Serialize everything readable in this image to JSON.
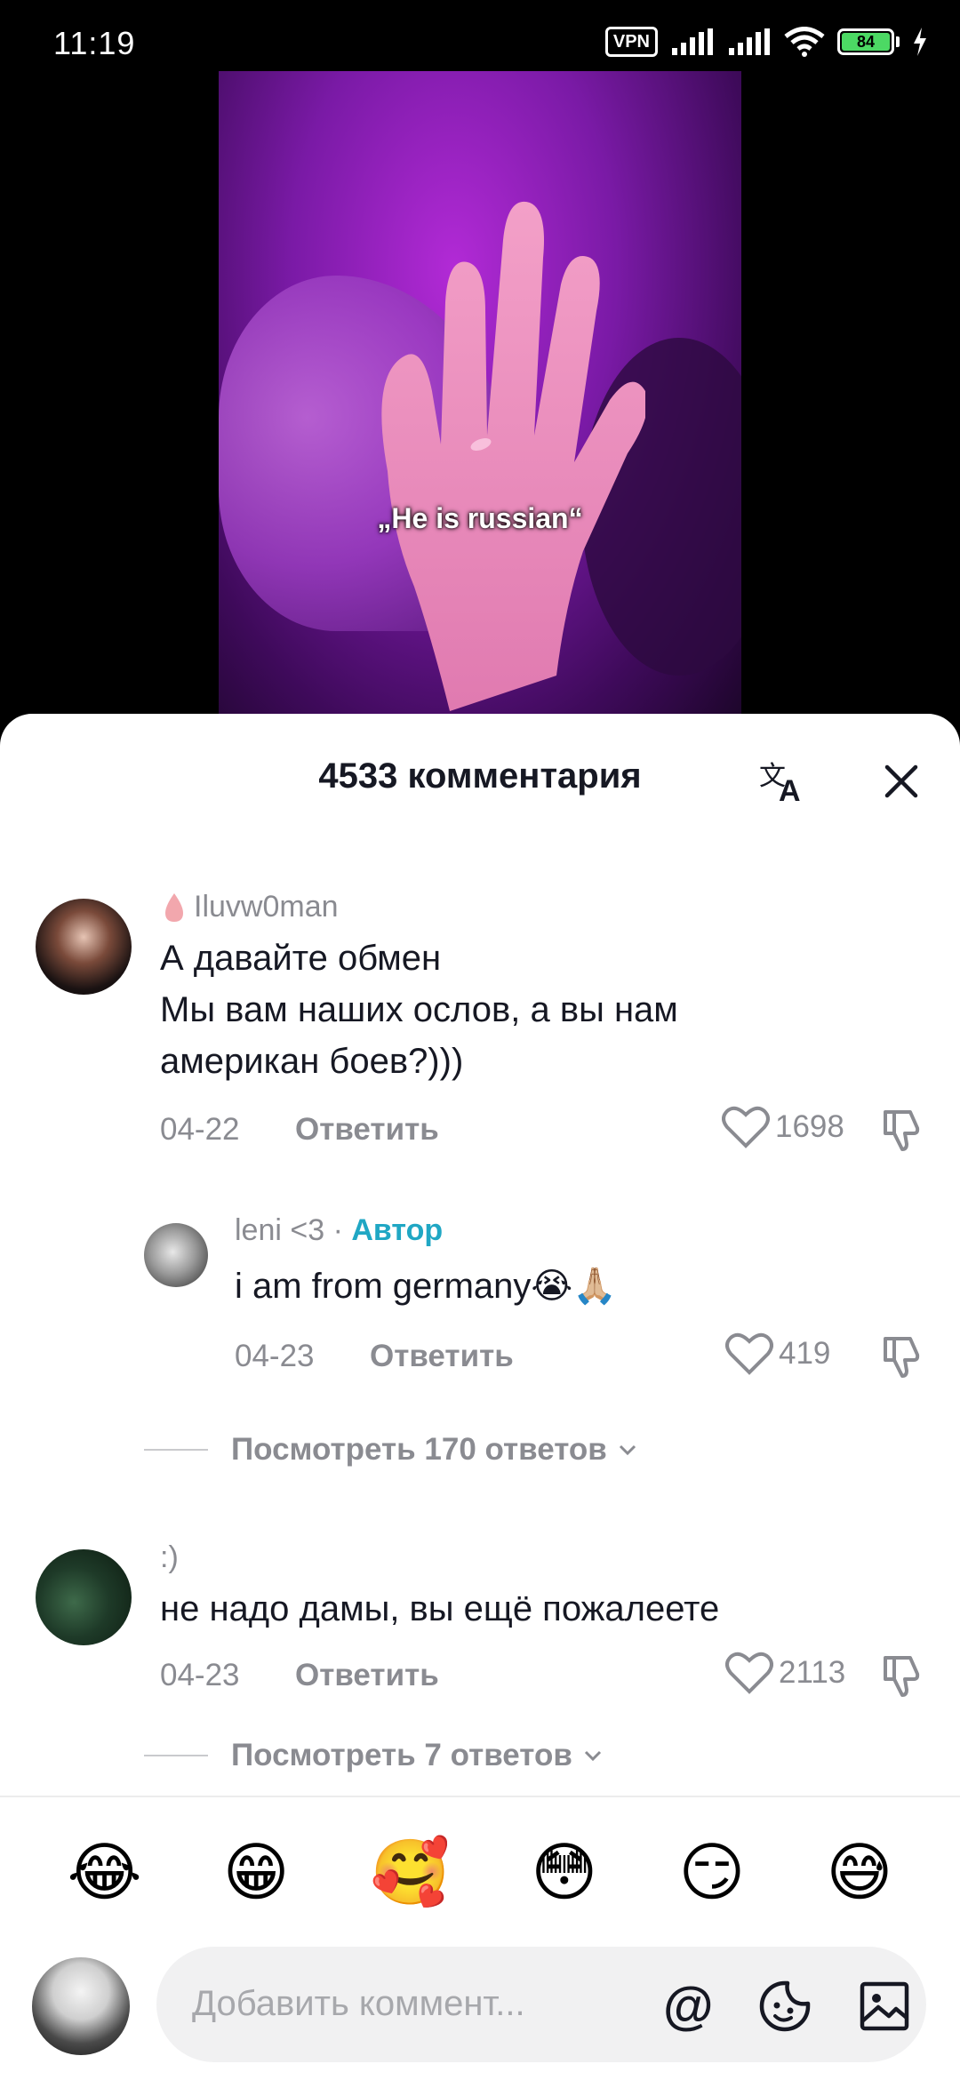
{
  "status": {
    "time": "11:19",
    "vpn": "VPN",
    "battery": "84"
  },
  "video": {
    "caption": "„He is russian“"
  },
  "sheet": {
    "title": "4533 комментария"
  },
  "comments": [
    {
      "username": "Iluvw0man",
      "text_lines": [
        "А давайте обмен",
        "Мы вам наших ослов, а вы нам",
        "американ боев?)))"
      ],
      "date": "04-22",
      "reply_label": "Ответить",
      "likes": "1698"
    },
    {
      "username": "leni <3",
      "author_separator": "·",
      "author_tag": "Автор",
      "text": "i am from germany😭🙏🏼",
      "date": "04-23",
      "reply_label": "Ответить",
      "likes": "419"
    },
    {
      "username": ":)",
      "text": "не надо дамы, вы ещё пожалеете",
      "date": "04-23",
      "reply_label": "Ответить",
      "likes": "2113"
    }
  ],
  "view_replies": [
    {
      "label": "Посмотреть 170 ответов"
    },
    {
      "label": "Посмотреть 7 ответов"
    }
  ],
  "emoji_bar": [
    "😂",
    "😁",
    "🥰",
    "😳",
    "😏",
    "😅"
  ],
  "input": {
    "placeholder": "Добавить коммент..."
  },
  "colors": {
    "author_tag": "#20a7c4",
    "secondary_text": "#8a8b91",
    "primary_text": "#161823",
    "input_bg": "#f1f1f2"
  },
  "icons": [
    "vpn-icon",
    "signal-icon",
    "wifi-icon",
    "battery-icon",
    "charging-icon",
    "translate-icon",
    "close-icon",
    "heart-icon",
    "dislike-icon",
    "chevron-down-icon",
    "mention-icon",
    "sticker-icon",
    "image-icon"
  ]
}
